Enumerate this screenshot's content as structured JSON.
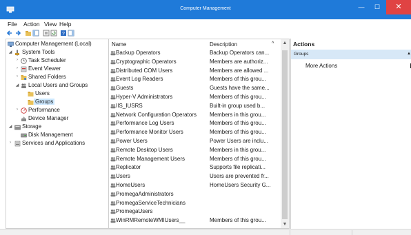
{
  "window": {
    "title": "Computer Management",
    "minimize_glyph": "—",
    "maximize_glyph": "☐",
    "close_glyph": "✕"
  },
  "menu": [
    "File",
    "Action",
    "View",
    "Help"
  ],
  "toolbar": {
    "icons": [
      "back-arrow-icon",
      "forward-arrow-icon",
      "up-folder-icon",
      "show-tree-icon",
      "properties-icon",
      "refresh-icon",
      "help-icon",
      "show-action-pane-icon"
    ]
  },
  "tree": [
    {
      "label": "Computer Management (Local)",
      "expanded": null
    },
    {
      "label": "System Tools",
      "expanded": true
    },
    {
      "label": "Task Scheduler",
      "expanded": false
    },
    {
      "label": "Event Viewer",
      "expanded": false
    },
    {
      "label": "Shared Folders",
      "expanded": false
    },
    {
      "label": "Local Users and Groups",
      "expanded": true
    },
    {
      "label": "Users",
      "expanded": null
    },
    {
      "label": "Groups",
      "expanded": null,
      "selected": true
    },
    {
      "label": "Performance",
      "expanded": false
    },
    {
      "label": "Device Manager",
      "expanded": null
    },
    {
      "label": "Storage",
      "expanded": true
    },
    {
      "label": "Disk Management",
      "expanded": null
    },
    {
      "label": "Services and Applications",
      "expanded": false
    }
  ],
  "list": {
    "columns": [
      "Name",
      "Description"
    ],
    "sort_indicator": "^",
    "rows": [
      {
        "name": "Backup Operators",
        "description": "Backup Operators can..."
      },
      {
        "name": "Cryptographic Operators",
        "description": "Members are authoriz..."
      },
      {
        "name": "Distributed COM Users",
        "description": "Members are allowed ..."
      },
      {
        "name": "Event Log Readers",
        "description": "Members of this grou..."
      },
      {
        "name": "Guests",
        "description": "Guests have the same..."
      },
      {
        "name": "Hyper-V Administrators",
        "description": "Members of this grou..."
      },
      {
        "name": "IIS_IUSRS",
        "description": "Built-in group used b..."
      },
      {
        "name": "Network Configuration Operators",
        "description": "Members in this grou..."
      },
      {
        "name": "Performance Log Users",
        "description": "Members of this grou..."
      },
      {
        "name": "Performance Monitor Users",
        "description": "Members of this grou..."
      },
      {
        "name": "Power Users",
        "description": "Power Users are inclu..."
      },
      {
        "name": "Remote Desktop Users",
        "description": "Members in this grou..."
      },
      {
        "name": "Remote Management Users",
        "description": "Members of this grou..."
      },
      {
        "name": "Replicator",
        "description": "Supports file replicati..."
      },
      {
        "name": "Users",
        "description": "Users are prevented fr..."
      },
      {
        "name": "HomeUsers",
        "description": "HomeUsers Security G..."
      },
      {
        "name": "PromegaAdministrators",
        "description": ""
      },
      {
        "name": "PromegaServiceTechnicians",
        "description": ""
      },
      {
        "name": "PromegaUsers",
        "description": ""
      },
      {
        "name": "WinRMRemoteWMIUsers__",
        "description": "Members of this grou..."
      }
    ]
  },
  "actions": {
    "title": "Actions",
    "section": "Groups",
    "links": [
      "More Actions"
    ]
  },
  "colors": {
    "titlebar": "#1f7ad9",
    "close_button": "#e04343",
    "selection": "#cce8ff",
    "actions_section": "#d7e8f7"
  }
}
